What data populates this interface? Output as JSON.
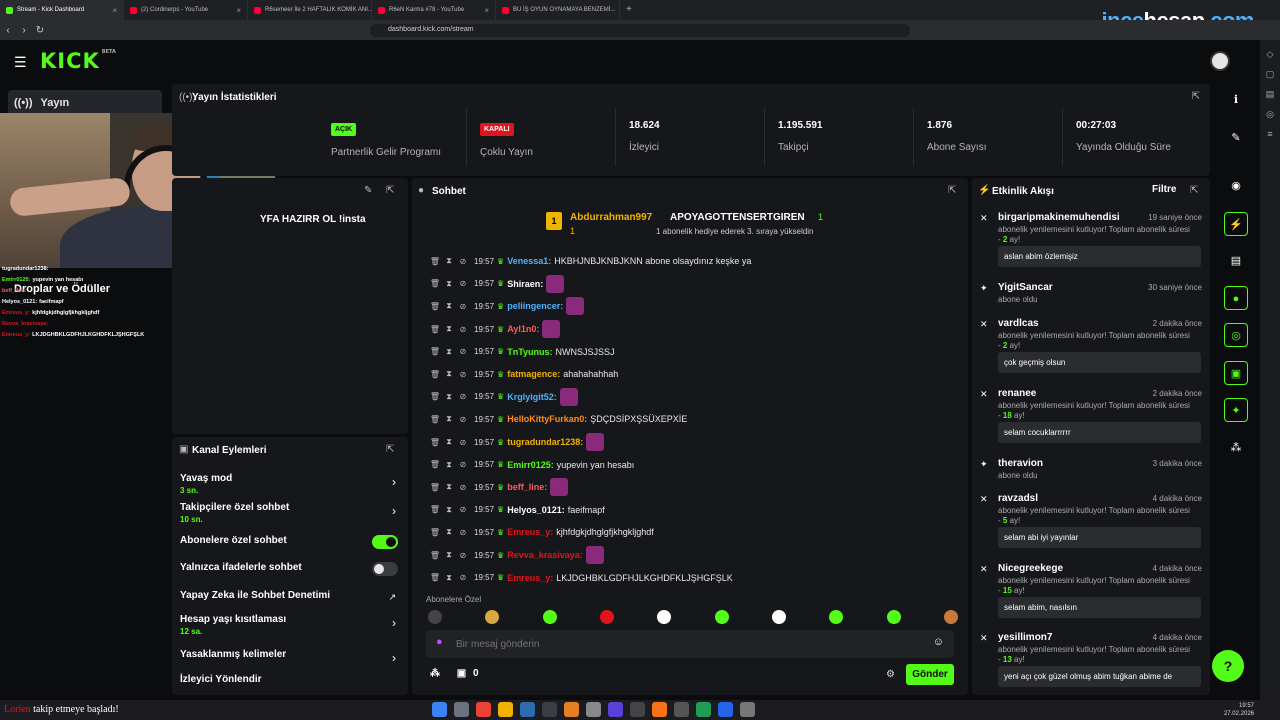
{
  "browser": {
    "tabs": [
      {
        "title": "Stream - Kick Dashboard",
        "active": true,
        "icon": "kick"
      },
      {
        "title": "(2) Cordinerps - YouTube",
        "active": false,
        "icon": "youtube"
      },
      {
        "title": "R6semeer İle 2 HAFTALIK KOMİK ANI...",
        "active": false,
        "icon": "youtube"
      },
      {
        "title": "R6eN Karma #78 - YouTube",
        "active": false,
        "icon": "youtube"
      },
      {
        "title": "BU İŞ OYUN OYNAMAYA BENZEMİ...",
        "active": false,
        "icon": "youtube"
      }
    ],
    "url": "dashboard.kick.com/stream",
    "watermark_a": "ince",
    "watermark_b": "hesap",
    "watermark_c": ".com"
  },
  "header": {
    "logo": "KICK",
    "logo_beta": "BETA"
  },
  "leftnav": {
    "active_label": "Yayın",
    "droplar": "Droplar ve Ödüller"
  },
  "overlay_chat": [
    {
      "user": "tugradundar1238:",
      "text": "",
      "color": "#ffffff"
    },
    {
      "user": "Emirr0125:",
      "text": "yupevin yan hesabı",
      "color": "#53fc18"
    },
    {
      "user": "beff_line:",
      "text": "",
      "color": "#ff5a5a"
    },
    {
      "user": "Helyos_0121:",
      "text": "faeifmapf",
      "color": "#ffffff"
    },
    {
      "user": "Emreus_y:",
      "text": "kjhfdgkjdhglgfjkhgkljghdf",
      "color": "#e0141c"
    },
    {
      "user": "Revva_krasivaya:",
      "text": "",
      "color": "#e0141c"
    },
    {
      "user": "Emreus_y:",
      "text": "LKJDGHBKLGDFHJLKGHDFKLJŞHGFŞLK",
      "color": "#e0141c"
    }
  ],
  "stats": {
    "title": "Yayın İstatistikleri",
    "partner_badge": "AÇIK",
    "partner_label": "Partnerlik Gelir Programı",
    "multi_badge": "KAPALI",
    "multi_label": "Çoklu Yayın",
    "viewers_val": "18.624",
    "viewers_lbl": "İzleyici",
    "followers_val": "1.195.591",
    "followers_lbl": "Takipçi",
    "subs_val": "1.876",
    "subs_lbl": "Abone Sayısı",
    "uptime_val": "00:27:03",
    "uptime_lbl": "Yayında Olduğu Süre"
  },
  "info": {
    "text": "YFA HAZIRR OL !insta"
  },
  "actions": {
    "title": "Kanal Eylemleri",
    "slow_mode": "Yavaş mod",
    "slow_mode_val": "3 sn.",
    "followers_chat": "Takipçilere özel sohbet",
    "followers_chat_val": "10 sn.",
    "subs_chat": "Abonelere özel sohbet",
    "emote_chat": "Yalnızca ifadelerle sohbet",
    "ai_moderation": "Yapay Zeka ile Sohbet Denetimi",
    "account_age": "Hesap yaşı kısıtlaması",
    "account_age_val": "12 sa.",
    "banned_words": "Yasaklanmış kelimeler",
    "redirect": "İzleyici Yönlendir"
  },
  "chat": {
    "title": "Sohbet",
    "pinned_from": "Abdurrahman997",
    "pinned_from_rank": "1",
    "pinned_from_count": "1",
    "pinned_to": "APOYAGOTTENSERTGIREN",
    "pinned_to_count": "1",
    "pinned_desc": "1 abonelik hediye ederek 3. sıraya yükseldin",
    "messages": [
      {
        "time": "19:57",
        "user": "Venessa1:",
        "color": "#4db3ff",
        "text": "HKBHJNBJKNBJKNN abone olsaydınız keşke ya",
        "emote": false
      },
      {
        "time": "19:57",
        "user": "Shiraen:",
        "color": "#ffffff",
        "text": "",
        "emote": true
      },
      {
        "time": "19:57",
        "user": "peliingencer:",
        "color": "#4db3ff",
        "text": "",
        "emote": true
      },
      {
        "time": "19:57",
        "user": "Ayl1n0:",
        "color": "#ff5a5a",
        "text": "",
        "emote": true
      },
      {
        "time": "19:57",
        "user": "TnTyunus:",
        "color": "#53fc18",
        "text": "NWNSJSJSSJ",
        "emote": false
      },
      {
        "time": "19:57",
        "user": "fatmagence:",
        "color": "#f0b400",
        "text": "ahahahahhah",
        "emote": false
      },
      {
        "time": "19:57",
        "user": "Krglyigit52:",
        "color": "#4db3ff",
        "text": "",
        "emote": true
      },
      {
        "time": "19:57",
        "user": "HelloKittyFurkan0:",
        "color": "#ff8c1a",
        "text": "ŞDÇDSİPXŞSÜXEPXİE",
        "emote": false
      },
      {
        "time": "19:57",
        "user": "tugradundar1238:",
        "color": "#f0b400",
        "text": "",
        "emote": true
      },
      {
        "time": "19:57",
        "user": "Emirr0125:",
        "color": "#53fc18",
        "text": "yupevin yan hesabı",
        "emote": false
      },
      {
        "time": "19:57",
        "user": "beff_line:",
        "color": "#ff5a5a",
        "text": "",
        "emote": true
      },
      {
        "time": "19:57",
        "user": "Helyos_0121:",
        "color": "#ffffff",
        "text": "faeifmapf",
        "emote": false
      },
      {
        "time": "19:57",
        "user": "Emreus_y:",
        "color": "#e0141c",
        "text": "kjhfdgkjdhglgfjkhgkljghdf",
        "emote": false
      },
      {
        "time": "19:57",
        "user": "Revva_krasivaya:",
        "color": "#e0141c",
        "text": "",
        "emote": true
      },
      {
        "time": "19:57",
        "user": "Emreus_y:",
        "color": "#e0141c",
        "text": "LKJDGHBKLGDFHJLKGHDFKLJŞHGFŞLK",
        "emote": false
      }
    ],
    "subs_only_label": "Abonelere Özel",
    "input_placeholder": "Bir mesaj gönderin",
    "send_label": "Gönder",
    "footer_count": "0"
  },
  "feed": {
    "title": "Etkinlik Akışı",
    "filter": "Filtre",
    "items": [
      {
        "name": "birgaripmakinemuhendisi",
        "time": "19 saniye önce",
        "desc": "abonelik yenilemesini kutluyor! Toplam abonelik süresi - ",
        "months": "2",
        "suffix": " ay!",
        "message": "aslan abim özlemişiz"
      },
      {
        "name": "YigitSancar",
        "time": "30 saniye önce",
        "desc": "abone oldu",
        "months": "",
        "suffix": "",
        "message": ""
      },
      {
        "name": "vardlcas",
        "time": "2 dakika önce",
        "desc": "abonelik yenilemesini kutluyor! Toplam abonelik süresi - ",
        "months": "2",
        "suffix": " ay!",
        "message": "çok geçmiş olsun"
      },
      {
        "name": "renanee",
        "time": "2 dakika önce",
        "desc": "abonelik yenilemesini kutluyor! Toplam abonelik süresi - ",
        "months": "18",
        "suffix": " ay!",
        "message": "selam cocuklarrrrrr"
      },
      {
        "name": "theravion",
        "time": "3 dakika önce",
        "desc": "abone oldu",
        "months": "",
        "suffix": "",
        "message": ""
      },
      {
        "name": "ravzadsl",
        "time": "4 dakika önce",
        "desc": "abonelik yenilemesini kutluyor! Toplam abonelik süresi - ",
        "months": "5",
        "suffix": " ay!",
        "message": "selam abi iyi yayınlar"
      },
      {
        "name": "Nicegreekege",
        "time": "4 dakika önce",
        "desc": "abonelik yenilemesini kutluyor! Toplam abonelik süresi - ",
        "months": "15",
        "suffix": " ay!",
        "message": "selam abim, nasılsın"
      },
      {
        "name": "yesillimon7",
        "time": "4 dakika önce",
        "desc": "abonelik yenilemesini kutluyor! Toplam abonelik süresi - ",
        "months": "13",
        "suffix": " ay!",
        "message": "yeni açı çok güzel olmuş abim tuğkan abime de"
      }
    ]
  },
  "taskbar": {
    "toast_user": "Lorien",
    "toast_text": "takip etmeye başladı!",
    "clock_time": "19:57",
    "clock_date": "27.02.2026"
  },
  "colors": {
    "accent": "#53fc18",
    "danger": "#e0141c",
    "panel": "#16171a",
    "bg": "#0b0c0e"
  }
}
